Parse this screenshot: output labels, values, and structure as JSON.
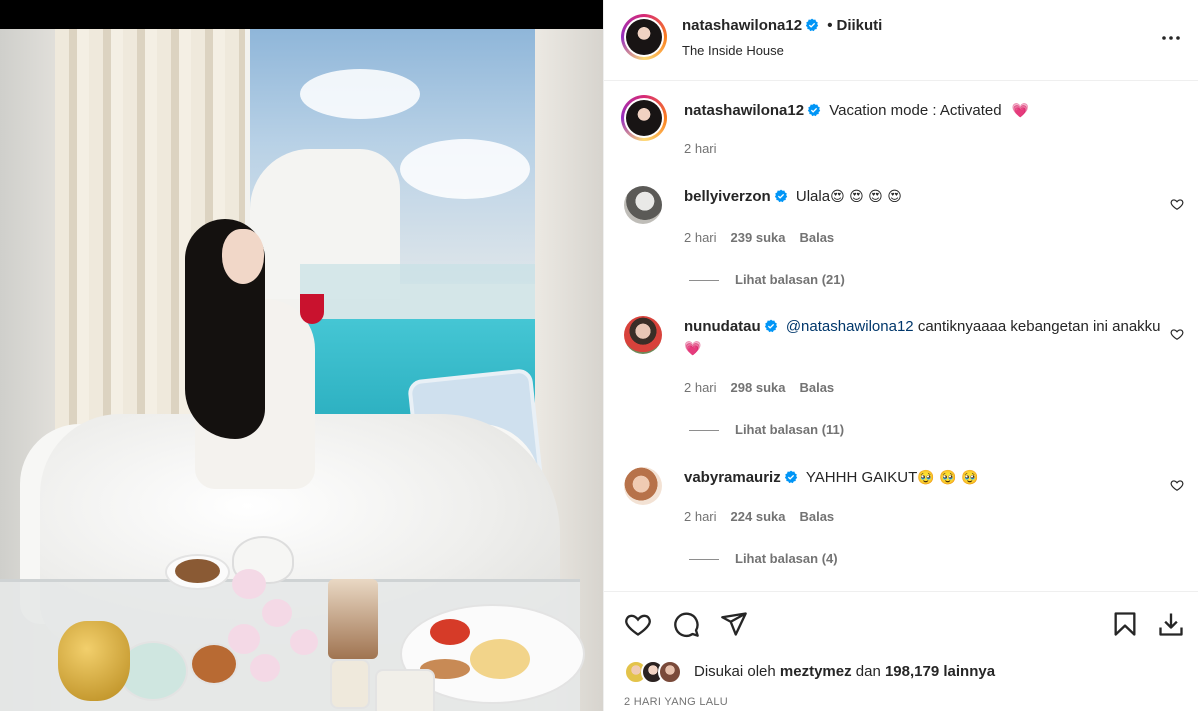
{
  "post": {
    "author": "natashawilona12",
    "follow_status": "Diikuti",
    "location": "The Inside House",
    "caption": "Vacation mode : Activated",
    "caption_emoji": "💗",
    "caption_age": "2 hari",
    "liked_by_user": "meztymez",
    "likes_prefix": "Disukai oleh",
    "likes_connector": "dan",
    "likes_others": "198,179 lainnya",
    "timestamp": "2 HARI YANG LALU"
  },
  "comments": [
    {
      "user": "bellyiverzon",
      "text": "Ulala",
      "emoji": "😍 😍 😍 😍",
      "age": "2 hari",
      "likes": "239 suka",
      "reply_label": "Balas",
      "view_replies": "Lihat balasan (21)"
    },
    {
      "user": "nunudatau",
      "mention": "@natashawilona12",
      "text": " cantiknyaaaa kebangetan ini anakku",
      "emoji": "💗",
      "age": "2 hari",
      "likes": "298 suka",
      "reply_label": "Balas",
      "view_replies": "Lihat balasan (11)"
    },
    {
      "user": "vabyramauriz",
      "text": "YAHHH GAIKUT",
      "emoji": "🥹 🥹 🥹",
      "age": "2 hari",
      "likes": "224 suka",
      "reply_label": "Balas",
      "view_replies": "Lihat balasan (4)"
    }
  ],
  "icons": {
    "more": "more-horizontal-icon",
    "like": "heart-icon",
    "comment": "comment-bubble-icon",
    "share": "paper-plane-icon",
    "save": "bookmark-icon",
    "download": "download-icon",
    "verified": "verified-badge-icon"
  },
  "colors": {
    "verified": "#0095f6",
    "text": "#262626",
    "secondary": "#737373",
    "mention": "#00376b"
  }
}
